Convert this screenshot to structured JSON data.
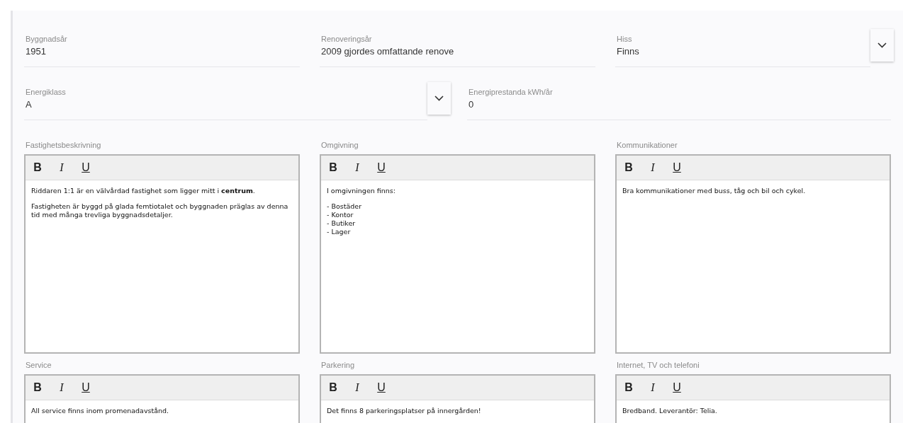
{
  "fields_row_1": [
    {
      "kind": "text",
      "label": "Byggnadsår",
      "value": "1951"
    },
    {
      "kind": "text",
      "label": "Renoveringsår",
      "value": "2009 gjordes omfattande renove"
    },
    {
      "kind": "select",
      "label": "Hiss",
      "value": "Finns"
    }
  ],
  "fields_row_2": [
    {
      "kind": "select",
      "label": "Energiklass",
      "value": "A"
    },
    {
      "kind": "text",
      "label": "Energiprestanda kWh/år",
      "value": "0"
    }
  ],
  "editors": [
    {
      "label": "Fastighetsbeskrivning",
      "toolbar": [
        {
          "kind": "bold",
          "label": "B"
        },
        {
          "kind": "italic",
          "label": "I"
        },
        {
          "kind": "underline",
          "label": "U"
        }
      ],
      "paragraphs": [
        {
          "lines": [
            "Riddaren 1:1 är en välvårdad fastighet som ligger mitt i **centrum**."
          ]
        },
        {
          "lines": [
            "Fastigheten är byggd på glada femtiotalet och byggnaden präglas av denna tid med många trevliga byggnadsdetaljer."
          ]
        }
      ]
    },
    {
      "label": "Omgivning",
      "toolbar": [
        {
          "kind": "bold",
          "label": "B"
        },
        {
          "kind": "italic",
          "label": "I"
        },
        {
          "kind": "underline",
          "label": "U"
        }
      ],
      "paragraphs": [
        {
          "lines": [
            "I omgivningen finns:"
          ]
        },
        {
          "lines": [
            "- Bostäder",
            "- Kontor",
            "- Butiker",
            "- Lager"
          ]
        }
      ]
    },
    {
      "label": "Kommunikationer",
      "toolbar": [
        {
          "kind": "bold",
          "label": "B"
        },
        {
          "kind": "italic",
          "label": "I"
        },
        {
          "kind": "underline",
          "label": "U"
        }
      ],
      "paragraphs": [
        {
          "lines": [
            "Bra kommunikationer med buss, tåg och bil och cykel."
          ]
        }
      ]
    },
    {
      "label": "Service",
      "toolbar": [
        {
          "kind": "bold",
          "label": "B"
        },
        {
          "kind": "italic",
          "label": "I"
        },
        {
          "kind": "underline",
          "label": "U"
        }
      ],
      "paragraphs": [
        {
          "lines": [
            "All service finns inom promenadavstånd."
          ]
        }
      ]
    },
    {
      "label": "Parkering",
      "toolbar": [
        {
          "kind": "bold",
          "label": "B"
        },
        {
          "kind": "italic",
          "label": "I"
        },
        {
          "kind": "underline",
          "label": "U"
        }
      ],
      "paragraphs": [
        {
          "lines": [
            "Det finns 8 parkeringsplatser på innergården!"
          ]
        }
      ]
    },
    {
      "label": "Internet, TV och telefoni",
      "toolbar": [
        {
          "kind": "bold",
          "label": "B"
        },
        {
          "kind": "italic",
          "label": "I"
        },
        {
          "kind": "underline",
          "label": "U"
        }
      ],
      "paragraphs": [
        {
          "lines": [
            "Bredband. Leverantör: Telia."
          ]
        }
      ]
    }
  ]
}
